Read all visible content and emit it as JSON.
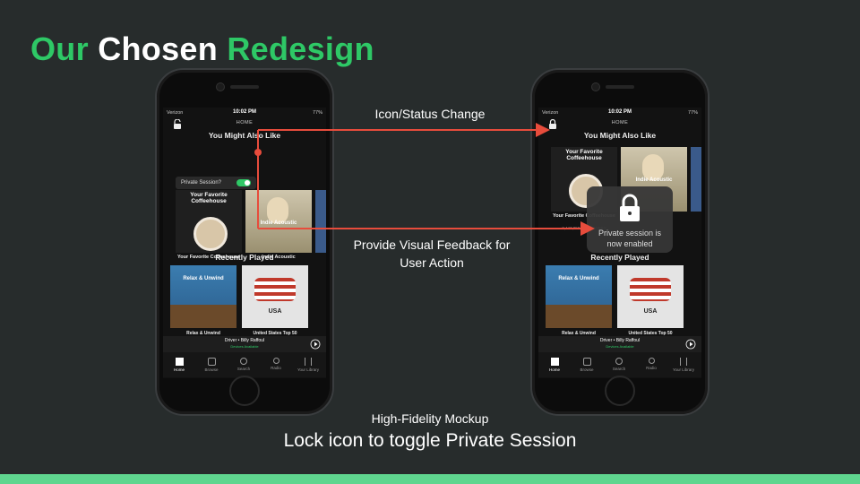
{
  "slide": {
    "title_part1": "Our",
    "title_part2": "Chosen",
    "title_part3": "Redesign",
    "annotation_icon": "Icon/Status Change",
    "annotation_feedback_line1": "Provide Visual Feedback for",
    "annotation_feedback_line2": "User Action",
    "subtitle_small": "High-Fidelity Mockup",
    "subtitle_large": "Lock icon to toggle Private Session"
  },
  "colors": {
    "accent_green": "#2ec866",
    "arrow_red": "#e74c3c",
    "background": "#272c2c",
    "bottom_bar": "#5fd68f"
  },
  "phone": {
    "carrier": "Verizon",
    "time": "10:02 PM",
    "battery": "77%",
    "home_label": "HOME",
    "section1": "You Might Also Like",
    "card1_art": "Your Favorite Coffeehouse",
    "card1_caption": "Your Favorite Coffeehouse",
    "card1_sub": "3,447,050 FOLLOWERS",
    "card2_art": "Indie Acoustic",
    "card2_caption": "Indie Acoustic",
    "section2": "Recently Played",
    "card3_art": "Relax & Unwind",
    "card3_caption": "Relax & Unwind",
    "card3_sub": "Playlist • by Spotify",
    "card4_art": "USA",
    "card4_caption": "United States Top 50",
    "card4_sub": "Playlist • by spotifycharts",
    "now_playing": "Driver • Billy Raffoul",
    "now_playing_sub": "Devices Available",
    "tabs": [
      "Home",
      "Browse",
      "Search",
      "Radio",
      "Your Library"
    ],
    "private_prompt": "Private Session?",
    "toast_line1": "Private session is",
    "toast_line2": "now enabled"
  },
  "icons": {
    "lock": "lock-icon",
    "unlock": "unlock-icon",
    "toggle": "toggle-switch",
    "play": "play-icon"
  }
}
